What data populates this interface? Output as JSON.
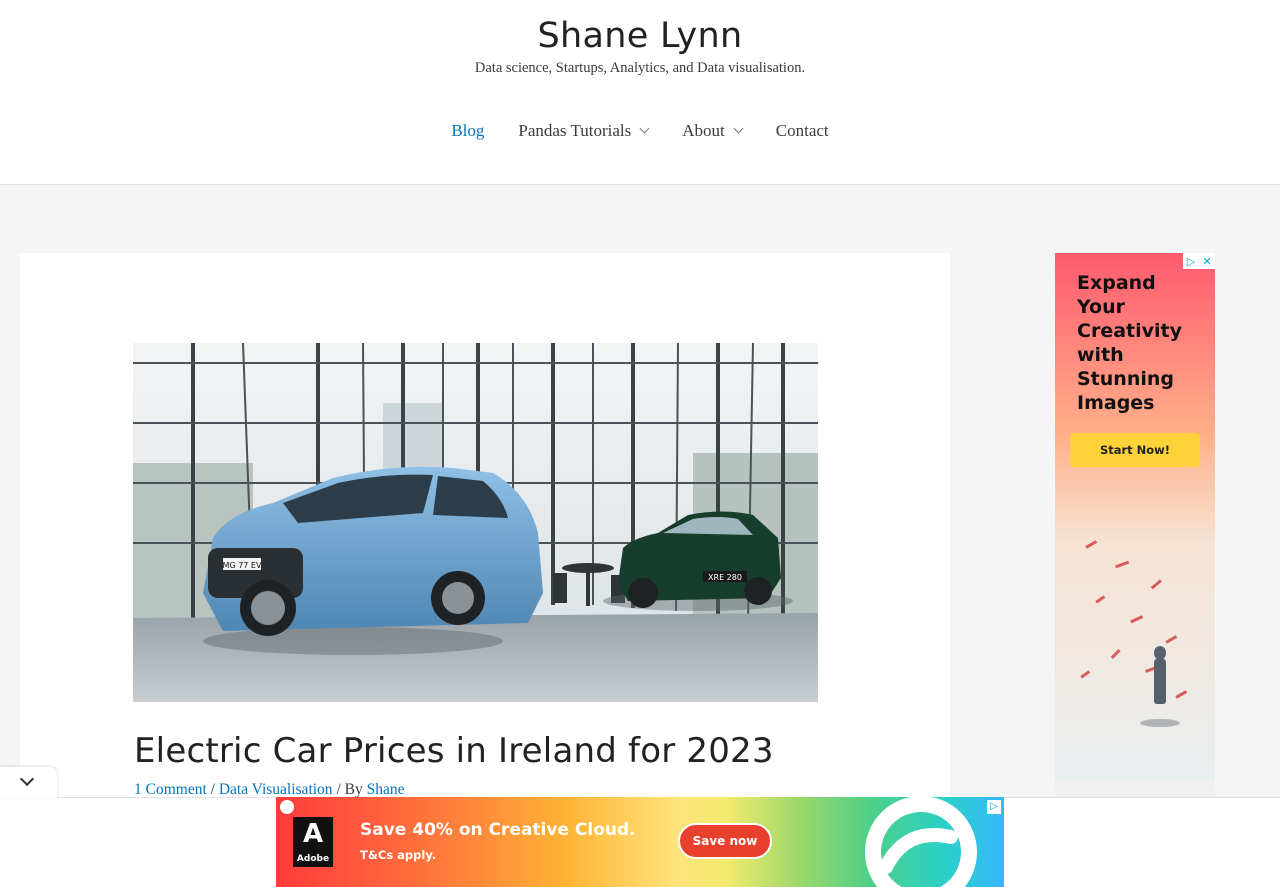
{
  "header": {
    "site_title": "Shane Lynn",
    "tagline": "Data science, Startups, Analytics, and Data visualisation."
  },
  "nav": {
    "items": [
      {
        "label": "Blog",
        "active": true,
        "has_dropdown": false
      },
      {
        "label": "Pandas Tutorials",
        "active": false,
        "has_dropdown": true
      },
      {
        "label": "About",
        "active": false,
        "has_dropdown": true
      },
      {
        "label": "Contact",
        "active": false,
        "has_dropdown": false
      }
    ]
  },
  "post": {
    "title": "Electric Car Prices in Ireland for 2023",
    "comments": "1 Comment",
    "sep1": " / ",
    "category": "Data Visualisation",
    "by": " / By ",
    "author": "Shane",
    "image_plates": [
      "MG 77 EV",
      "XRE 280"
    ]
  },
  "sidebar_ad": {
    "headline": "Expand Your Creativity with Stunning Images",
    "button": "Start Now!"
  },
  "bottom_ad": {
    "brand": "Adobe",
    "headline": "Save 40% on Creative Cloud.",
    "subtext": "T&Cs apply.",
    "button": "Save now"
  },
  "colors": {
    "link": "#0274be",
    "text": "#3a3a3a",
    "heading": "#222222"
  }
}
